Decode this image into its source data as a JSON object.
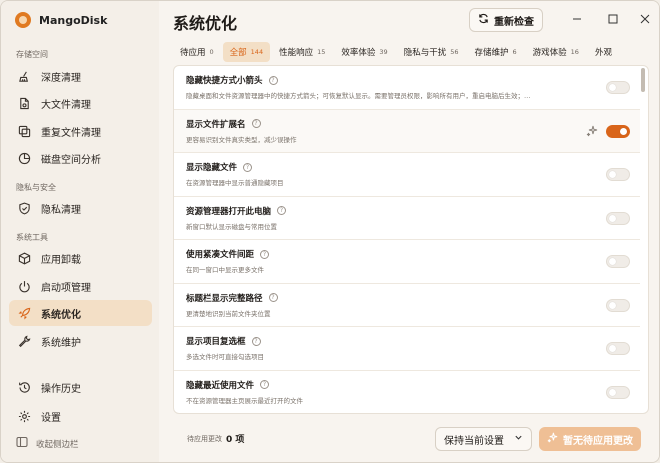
{
  "app": {
    "name": "MangoDisk"
  },
  "sidebar": {
    "sections": [
      {
        "label": "存储空间",
        "items": [
          {
            "label": "深度清理",
            "icon": "broom-icon"
          },
          {
            "label": "大文件清理",
            "icon": "file-icon"
          },
          {
            "label": "重复文件清理",
            "icon": "copy-icon"
          },
          {
            "label": "磁盘空间分析",
            "icon": "pie-chart-icon"
          }
        ]
      },
      {
        "label": "隐私与安全",
        "items": [
          {
            "label": "隐私清理",
            "icon": "shield-icon"
          }
        ]
      },
      {
        "label": "系统工具",
        "items": [
          {
            "label": "应用卸载",
            "icon": "package-icon"
          },
          {
            "label": "启动项管理",
            "icon": "power-icon"
          },
          {
            "label": "系统优化",
            "icon": "rocket-icon",
            "active": true
          },
          {
            "label": "系统维护",
            "icon": "wrench-icon"
          }
        ]
      }
    ],
    "bottom": [
      {
        "label": "操作历史",
        "icon": "history-icon"
      },
      {
        "label": "设置",
        "icon": "gear-icon"
      }
    ],
    "collapse_label": "收起侧边栏"
  },
  "header": {
    "title": "系统优化",
    "recheck_label": "重新检查"
  },
  "tabs": [
    {
      "label": "待应用",
      "count": "0"
    },
    {
      "label": "全部",
      "count": "144",
      "active": true
    },
    {
      "label": "性能响应",
      "count": "15"
    },
    {
      "label": "效率体验",
      "count": "39"
    },
    {
      "label": "隐私与干扰",
      "count": "56"
    },
    {
      "label": "存储维护",
      "count": "6"
    },
    {
      "label": "游戏体验",
      "count": "16"
    },
    {
      "label": "外观",
      "count": ""
    }
  ],
  "rows": [
    {
      "title": "隐藏快捷方式小箭头",
      "desc": "隐藏桌面和文件资源管理器中的快捷方式箭头；可恢复默认显示。需要管理员权限，影响所有用户，重启电脑后生效；…",
      "on": false
    },
    {
      "title": "显示文件扩展名",
      "desc": "更容易识别文件真实类型，减少误操作",
      "on": true,
      "sparkle": true
    },
    {
      "title": "显示隐藏文件",
      "desc": "在资源管理器中显示普通隐藏项目",
      "on": false
    },
    {
      "title": "资源管理器打开此电脑",
      "desc": "新窗口默认显示磁盘与常用位置",
      "on": false
    },
    {
      "title": "使用紧凑文件间距",
      "desc": "在同一窗口中显示更多文件",
      "on": false
    },
    {
      "title": "标题栏显示完整路径",
      "desc": "更清楚地识别当前文件夹位置",
      "on": false
    },
    {
      "title": "显示项目复选框",
      "desc": "多选文件时可直接勾选项目",
      "on": false
    },
    {
      "title": "隐藏最近使用文件",
      "desc": "不在资源管理器主页展示最近打开的文件",
      "on": false
    }
  ],
  "footer": {
    "pending_label": "待应用更改",
    "pending_count": "0 项",
    "select_value": "保持当前设置",
    "apply_label": "暂无待应用更改"
  },
  "colors": {
    "accent": "#d9651a",
    "active_bg": "#f3dfc6",
    "apply_disabled": "#efbf95"
  }
}
